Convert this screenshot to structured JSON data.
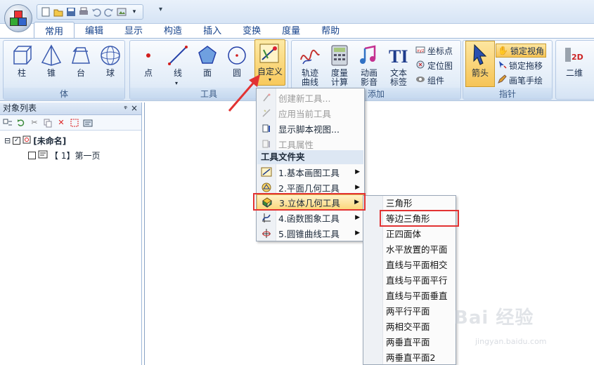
{
  "ribbon": {
    "tabs": [
      "常用",
      "编辑",
      "显示",
      "构造",
      "插入",
      "变换",
      "度量",
      "帮助"
    ],
    "groups": {
      "solid": {
        "label": "体",
        "buttons": [
          {
            "label": "柱",
            "icon": "prism-icon"
          },
          {
            "label": "锥",
            "icon": "pyramid-icon"
          },
          {
            "label": "台",
            "icon": "frustum-icon"
          },
          {
            "label": "球",
            "icon": "sphere-icon"
          }
        ]
      },
      "tools": {
        "label": "工具",
        "buttons": [
          {
            "label": "点",
            "icon": "point-icon"
          },
          {
            "label": "线",
            "icon": "line-icon"
          },
          {
            "label": "面",
            "icon": "polygon-icon"
          },
          {
            "label": "圆",
            "icon": "circle-icon"
          }
        ],
        "custom_label": "自定义"
      },
      "add": {
        "label": "添加",
        "buttons": [
          {
            "label": "轨迹\n曲线",
            "icon": "trace-curve-icon"
          },
          {
            "label": "度量\n计算",
            "icon": "calculator-icon"
          },
          {
            "label": "动画\n影音",
            "icon": "music-icon"
          },
          {
            "label": "文本\n标签",
            "icon": "text-label-icon"
          }
        ],
        "small": [
          "坐标点",
          "定位图",
          "组件"
        ]
      },
      "pointer": {
        "label": "指针",
        "arrow_label": "箭头",
        "small": [
          "锁定视角",
          "锁定拖移",
          "画笔手绘"
        ]
      },
      "view": {
        "label": "二维"
      }
    }
  },
  "panel": {
    "title": "对象列表",
    "pin": "ᵠ",
    "close": "×",
    "tree": {
      "root": "[未命名]",
      "page": "【 1】第一页"
    }
  },
  "menu": {
    "items": [
      "创建新工具...",
      "应用当前工具",
      "显示脚本视图...",
      "工具属性"
    ],
    "heading": "工具文件夹",
    "folders": [
      "1.基本画图工具",
      "2.平面几何工具",
      "3.立体几何工具",
      "4.函数图象工具",
      "5.圆锥曲线工具"
    ]
  },
  "submenu": {
    "items": [
      "三角形",
      "等边三角形",
      "正四面体",
      "水平放置的平面",
      "直线与平面相交",
      "直线与平面平行",
      "直线与平面垂直",
      "两平行平面",
      "两相交平面",
      "两垂直平面",
      "两垂直平面2"
    ]
  },
  "watermark": {
    "text": "Bai 经验",
    "url": "jingyan.baidu.com"
  },
  "colors": {
    "highlight": "#fbd77d",
    "annotation_red": "#e23232",
    "ribbon_blue": "#15428b"
  }
}
